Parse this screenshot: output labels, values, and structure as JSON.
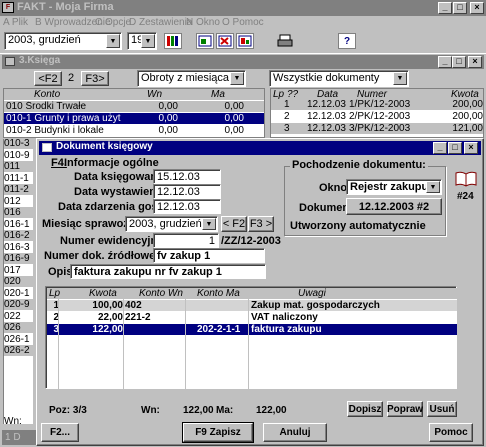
{
  "app": {
    "title": "FAKT - Moja Firma"
  },
  "menu": [
    "A Plik",
    "B Wprowadzenie",
    "C Opcje",
    "D Zestawienia",
    "N Okno",
    "O Pomoc"
  ],
  "toolbar": {
    "month": "2003, grudzień",
    "day": "19"
  },
  "ksiega": {
    "title": "3.Księga",
    "page": "2",
    "prev_label": "<F2",
    "next_label": "F3>",
    "turnover_select": "Obroty z miesiąca",
    "docs_select": "Wszystkie dokumenty",
    "account_headers": [
      "Konto",
      "Wn",
      "Ma"
    ],
    "accounts": [
      {
        "name": "010 Środki Trwałe",
        "wn": "0,00",
        "ma": "0,00"
      },
      {
        "name": "010-1 Grunty i prawa użyt",
        "wn": "0,00",
        "ma": "0,00"
      },
      {
        "name": "010-2 Budynki i lokale",
        "wn": "0,00",
        "ma": "0,00"
      }
    ],
    "account_stubs": [
      "010-3",
      "010-9",
      "011",
      "011-1",
      "011-2",
      "012",
      "016",
      "016-1",
      "016-2",
      "016-3",
      "016-9",
      "017",
      "020",
      "020-1",
      "020-9",
      "022",
      "026",
      "026-1",
      "026-2"
    ],
    "doc_headers": [
      "Lp",
      "??",
      "Data",
      "Numer",
      "Kwota"
    ],
    "docs": [
      {
        "lp": "1",
        "date": "12.12.03",
        "num": "1/PK/12-2003",
        "amount": "200,00"
      },
      {
        "lp": "2",
        "date": "12.12.03",
        "num": "2/PK/12-2003",
        "amount": "200,00"
      },
      {
        "lp": "3",
        "date": "12.12.03",
        "num": "3/PK/12-2003",
        "amount": "121,00"
      }
    ],
    "wn_label": "Wn:"
  },
  "dialog": {
    "title": "Dokument księgowy",
    "info_hotkey": "F4.",
    "info_title": " Informacje ogólne",
    "date_book_label": "Data księgowania",
    "date_book": "15.12.03",
    "date_issue_label": "Data wystawienia",
    "date_issue": "12.12.03",
    "date_event_label": "Data zdarzenia gosp.",
    "date_event": "12.12.03",
    "month_label": "Miesiąc sprawozd.",
    "month": "2003, grudzień",
    "month_prev": "< F2",
    "month_next": "F3 >",
    "evid_label": "Numer ewidencyjny",
    "evid_value": "1",
    "evid_suffix": "/ZZ/12-2003",
    "source_label": "Numer dok. źródłowego",
    "source_value": "fv zakup 1",
    "desc_label": "Opis",
    "desc_value": "faktura zakupu nr fv zakup 1",
    "origin_title": "Pochodzenie dokumentu:",
    "window_label": "Okno",
    "window_value": "Rejestr zakupu",
    "doc_label": "Dokument",
    "doc_value": "12.12.2003 #2",
    "auto_label": "Utworzony automatycznie",
    "book_num": "#24",
    "grid_headers": [
      "Lp",
      "Kwota",
      "Konto Wn",
      "Konto Ma",
      "Uwagi"
    ],
    "grid_rows": [
      {
        "lp": "1",
        "kwota": "100,00",
        "wn": "402",
        "ma": "",
        "uwagi": "Zakup mat. gospodarczych"
      },
      {
        "lp": "2",
        "kwota": "22,00",
        "wn": "221-2",
        "ma": "",
        "uwagi": "VAT naliczony"
      },
      {
        "lp": "3",
        "kwota": "122,00",
        "wn": "",
        "ma": "202-2-1-1",
        "uwagi": "faktura zakupu"
      }
    ],
    "pos_label": "Poz: 3/3",
    "wn_label": "Wn:",
    "wn_value": "122,00",
    "ma_label": "Ma:",
    "ma_value": "122,00",
    "add_btn": "Dopisz",
    "edit_btn": "Popraw",
    "del_btn": "Usuń",
    "f2_btn": "F2...",
    "save_btn": "F9 Zapisz",
    "cancel_btn": "Anuluj",
    "help_btn": "Pomoc"
  },
  "taskbar": {
    "item": "1 D"
  },
  "colors": {
    "titlebar_active": "#000080",
    "titlebar_inactive": "#808080",
    "selection": "#000080"
  }
}
